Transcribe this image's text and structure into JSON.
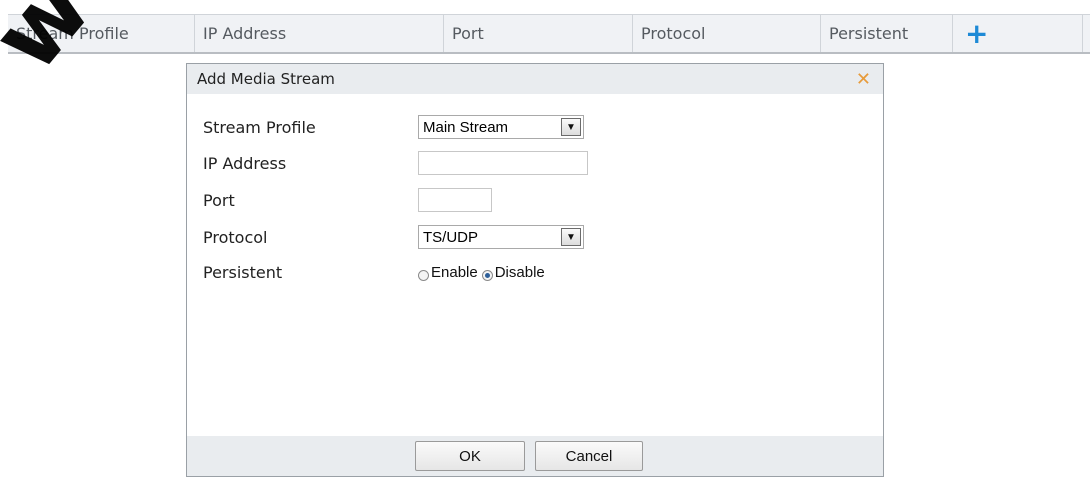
{
  "watermark": "www.",
  "table": {
    "columns": [
      "Stream Profile",
      "IP Address",
      "Port",
      "Protocol",
      "Persistent"
    ],
    "add_icon": "plus-icon"
  },
  "dialog": {
    "title": "Add Media Stream",
    "close_icon": "close-icon",
    "fields": {
      "stream_profile": {
        "label": "Stream Profile",
        "value": "Main Stream"
      },
      "ip_address": {
        "label": "IP Address",
        "value": ""
      },
      "port": {
        "label": "Port",
        "value": ""
      },
      "protocol": {
        "label": "Protocol",
        "value": "TS/UDP"
      },
      "persistent": {
        "label": "Persistent",
        "options": [
          "Enable",
          "Disable"
        ],
        "selected": "Disable"
      }
    },
    "buttons": {
      "ok": "OK",
      "cancel": "Cancel"
    }
  },
  "colors": {
    "accent_blue": "#1e8ad6",
    "close_orange": "#e79b3b",
    "header_bg": "#f0f2f5"
  }
}
